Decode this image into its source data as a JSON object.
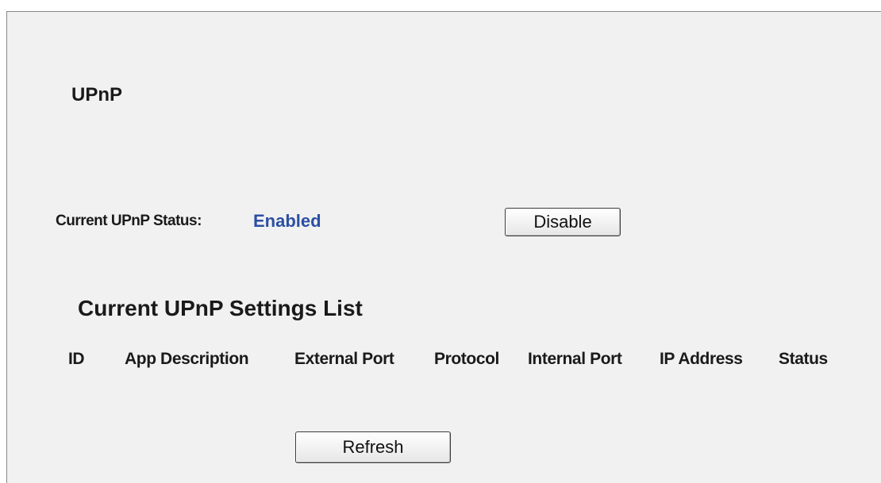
{
  "page": {
    "title": "UPnP"
  },
  "status": {
    "label": "Current UPnP Status:",
    "value": "Enabled",
    "value_color": "#2b4fa3",
    "toggle_button": "Disable"
  },
  "settings_list": {
    "title": "Current UPnP Settings List",
    "columns": [
      "ID",
      "App Description",
      "External Port",
      "Protocol",
      "Internal Port",
      "IP Address",
      "Status"
    ],
    "rows": []
  },
  "actions": {
    "refresh_label": "Refresh"
  }
}
